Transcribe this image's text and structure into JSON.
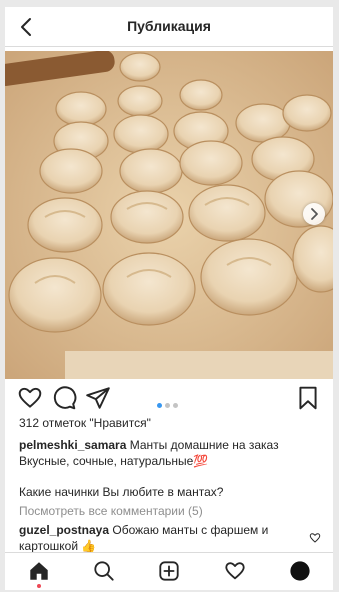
{
  "header": {
    "title": "Публикация"
  },
  "post": {
    "likes": "312 отметок \"Нравится\"",
    "username": "pelmeshki_samara",
    "caption_line1": "Манты домашние на заказ",
    "caption_line2": "Вкусные, сочные, натуральные💯",
    "caption_line3": "Какие начинки Вы любите в мантах?",
    "view_comments": "Посмотреть все комментарии (5)",
    "comment": {
      "username": "guzel_postnaya",
      "text": "Обожаю манты с фаршем и картошкой 👍"
    },
    "carousel": {
      "total": 3,
      "active": 1
    }
  },
  "icons": {
    "back": "chevron-left-icon",
    "like": "heart-icon",
    "comment": "speech-bubble-icon",
    "share": "paper-plane-icon",
    "save": "bookmark-icon",
    "home": "home-icon",
    "search": "search-icon",
    "add": "plus-square-icon",
    "activity": "heart-icon",
    "profile": "avatar-icon"
  },
  "colors": {
    "accent": "#3897f0",
    "notification": "#ed4956"
  }
}
